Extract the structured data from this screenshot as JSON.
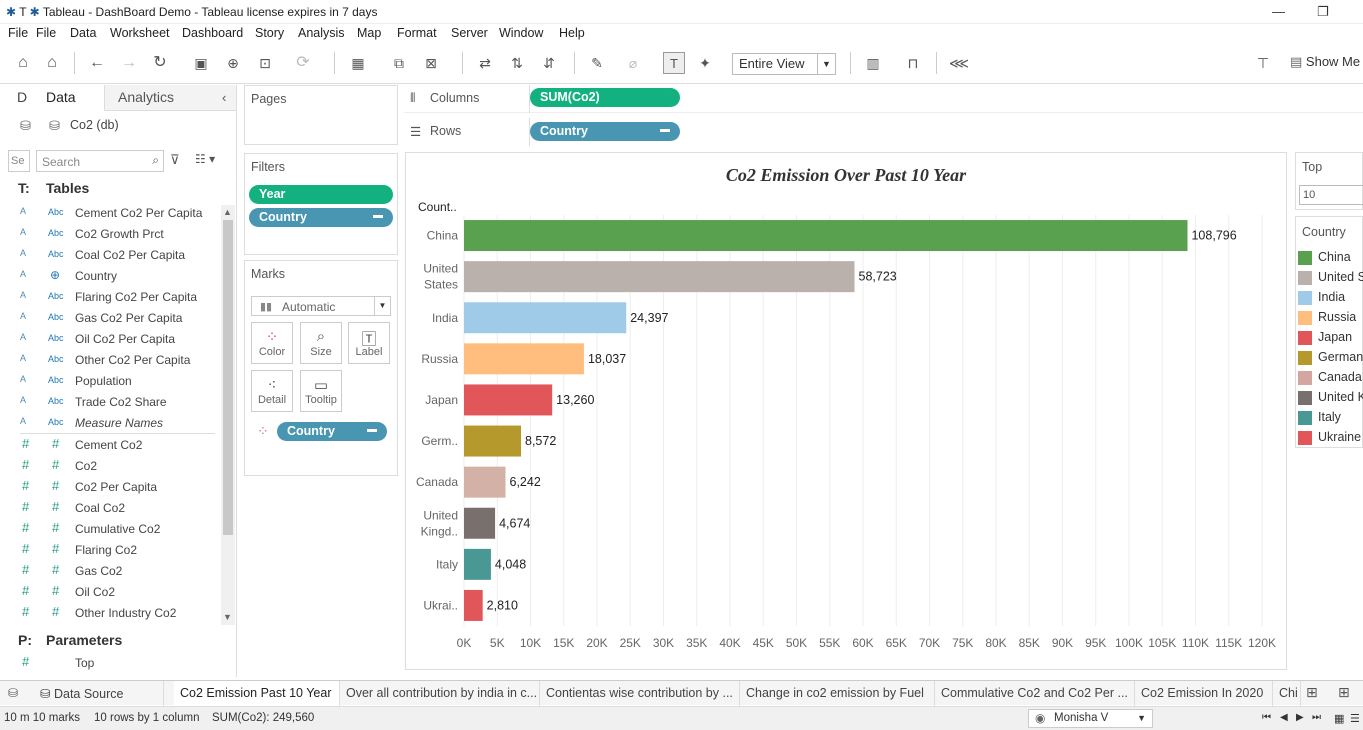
{
  "window": {
    "title": "Tableau - DashBoard Demo - Tableau license expires in 7 days",
    "app_short": "T"
  },
  "menu": [
    "File",
    "File",
    "Data",
    "Worksheet",
    "Dashboard",
    "Story",
    "Analysis",
    "Map",
    "Format",
    "Server",
    "Window",
    "Help"
  ],
  "toolbar": {
    "fit_select": "Entire View",
    "show_me": "Show Me"
  },
  "datapane": {
    "tab_d": "D",
    "tab_data": "Data",
    "tab_analytics": "Analytics",
    "datasource": "Co2 (db)",
    "search_placeholder": "Search",
    "search_short": "Se",
    "tables_header": "Tables",
    "tables_prefix": "T:",
    "dimensions": [
      {
        "type": "A",
        "icon": "Abc",
        "name": "Cement Co2 Per Capita"
      },
      {
        "type": "A",
        "icon": "Abc",
        "name": "Co2 Growth Prct"
      },
      {
        "type": "A",
        "icon": "Abc",
        "name": "Coal Co2 Per Capita"
      },
      {
        "type": "A",
        "icon": "globe",
        "name": "Country"
      },
      {
        "type": "A",
        "icon": "Abc",
        "name": "Flaring Co2 Per Capita"
      },
      {
        "type": "A",
        "icon": "Abc",
        "name": "Gas Co2 Per Capita"
      },
      {
        "type": "A",
        "icon": "Abc",
        "name": "Oil Co2 Per Capita"
      },
      {
        "type": "A",
        "icon": "Abc",
        "name": "Other Co2 Per Capita"
      },
      {
        "type": "A",
        "icon": "Abc",
        "name": "Population"
      },
      {
        "type": "A",
        "icon": "Abc",
        "name": "Trade Co2 Share"
      },
      {
        "type": "A",
        "icon": "Abc",
        "name": "Measure Names"
      }
    ],
    "measures": [
      "Cement Co2",
      "Co2",
      "Co2 Per Capita",
      "Coal Co2",
      "Cumulative Co2",
      "Flaring Co2",
      "Gas Co2",
      "Oil Co2",
      "Other Industry Co2"
    ],
    "parameters_header": "Parameters",
    "parameters_prefix": "P:",
    "parameters": [
      "Top"
    ]
  },
  "shelves": {
    "pages": "Pages",
    "columns_label": "Columns",
    "columns_pill": "SUM(Co2)",
    "rows_label": "Rows",
    "rows_pill": "Country",
    "filters": "Filters",
    "filter_pills": [
      "Year",
      "Country"
    ],
    "marks": "Marks",
    "mark_type": "Automatic",
    "mark_buttons": [
      "Color",
      "Size",
      "Label",
      "Detail",
      "Tooltip"
    ],
    "mark_pill": "Country"
  },
  "legend": {
    "top_title": "Top",
    "top_value": "10",
    "country_title": "Country",
    "items": [
      {
        "label": "China",
        "color": "#59a14f"
      },
      {
        "label": "United S",
        "color": "#bab0ac"
      },
      {
        "label": "India",
        "color": "#a0cbe8"
      },
      {
        "label": "Russia",
        "color": "#ffbe7d"
      },
      {
        "label": "Japan",
        "color": "#e15759"
      },
      {
        "label": "Germany",
        "color": "#b6992d"
      },
      {
        "label": "Canada",
        "color": "#d4a6a0"
      },
      {
        "label": "United K",
        "color": "#79706e"
      },
      {
        "label": "Italy",
        "color": "#499894"
      },
      {
        "label": "Ukraine",
        "color": "#e15759"
      }
    ]
  },
  "chart_data": {
    "type": "bar",
    "orientation": "horizontal",
    "title": "Co2 Emission Over Past 10 Year",
    "row_header": "Count..",
    "categories": [
      "China",
      "United States",
      "India",
      "Russia",
      "Japan",
      "Germ..",
      "Canada",
      "United Kingd..",
      "Italy",
      "Ukrai.."
    ],
    "values": [
      108796,
      58723,
      24397,
      18037,
      13260,
      8572,
      6242,
      4674,
      4048,
      2810
    ],
    "value_labels": [
      "108,796",
      "58,723",
      "24,397",
      "18,037",
      "13,260",
      "8,572",
      "6,242",
      "4,674",
      "4,048",
      "2,810"
    ],
    "colors": [
      "#59a14f",
      "#bab0ac",
      "#a0cbe8",
      "#ffbe7d",
      "#e15759",
      "#b6992d",
      "#d4b1a6",
      "#79706e",
      "#499894",
      "#e15759"
    ],
    "xlim": [
      0,
      120000
    ],
    "xticks": [
      "0K",
      "5K",
      "10K",
      "15K",
      "20K",
      "25K",
      "30K",
      "35K",
      "40K",
      "45K",
      "50K",
      "55K",
      "60K",
      "65K",
      "70K",
      "75K",
      "80K",
      "85K",
      "90K",
      "95K",
      "100K",
      "105K",
      "110K",
      "115K",
      "120K"
    ],
    "grid": true
  },
  "tabs": {
    "items": [
      "Data Source",
      "Co2 Emission Past 10 Year",
      "Over all contribution by india in c...",
      "Contientas wise contribution by ...",
      "Change in co2 emission by Fuel",
      "Commulative Co2 and Co2 Per ...",
      "Co2 Emission In 2020",
      "Chi"
    ],
    "active": 1
  },
  "status": {
    "marks": "10 m 10 marks",
    "rows": "10 rows by 1 column",
    "sum": "SUM(Co2): 249,560",
    "user": "Monisha V"
  }
}
